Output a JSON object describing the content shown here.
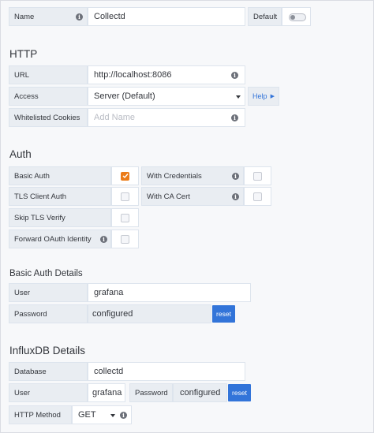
{
  "name_row": {
    "label": "Name",
    "value": "Collectd",
    "default_label": "Default",
    "default_on": false
  },
  "http": {
    "title": "HTTP",
    "url_label": "URL",
    "url_value": "http://localhost:8086",
    "access_label": "Access",
    "access_value": "Server (Default)",
    "help_label": "Help",
    "cookies_label": "Whitelisted Cookies",
    "cookies_placeholder": "Add Name"
  },
  "auth": {
    "title": "Auth",
    "basic_auth_label": "Basic Auth",
    "basic_auth_checked": true,
    "with_credentials_label": "With Credentials",
    "with_credentials_checked": false,
    "tls_client_label": "TLS Client Auth",
    "tls_client_checked": false,
    "with_ca_label": "With CA Cert",
    "with_ca_checked": false,
    "skip_tls_label": "Skip TLS Verify",
    "skip_tls_checked": false,
    "forward_oauth_label": "Forward OAuth Identity",
    "forward_oauth_checked": false
  },
  "basic_auth_details": {
    "title": "Basic Auth Details",
    "user_label": "User",
    "user_value": "grafana",
    "password_label": "Password",
    "password_value": "configured",
    "reset_label": "reset"
  },
  "influx": {
    "title": "InfluxDB Details",
    "database_label": "Database",
    "database_value": "collectd",
    "user_label": "User",
    "user_value": "grafana",
    "password_label": "Password",
    "password_value": "configured",
    "reset_label": "reset",
    "method_label": "HTTP Method",
    "method_value": "GET"
  },
  "colors": {
    "accent_orange": "#eb7b18",
    "reset_blue": "#3274d9",
    "label_bg": "#e9edf2",
    "page_bg": "#f7f8fa"
  }
}
